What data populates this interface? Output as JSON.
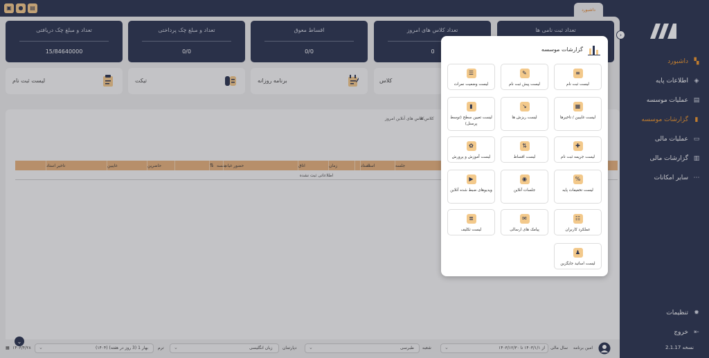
{
  "topbar": {
    "tab_label": "داشبورد"
  },
  "sidebar": {
    "items": [
      {
        "label": "داشبورد",
        "icon": "grid-icon"
      },
      {
        "label": "اطلاعات پایه",
        "icon": "layers-icon"
      },
      {
        "label": "عملیات موسسه",
        "icon": "clipboard-icon"
      },
      {
        "label": "گزارشات موسسه",
        "icon": "bar-chart-icon"
      },
      {
        "label": "عملیات مالی",
        "icon": "wallet-icon"
      },
      {
        "label": "گزارشات مالی",
        "icon": "finance-report-icon"
      },
      {
        "label": "سایر امکانات",
        "icon": "more-icon"
      }
    ],
    "settings": "تنظیمات",
    "logout": "خروج",
    "version": "نسخه 2.1.17"
  },
  "stats": [
    {
      "title": "تعداد ثبت نامی ها",
      "value": ""
    },
    {
      "title": "تعداد کلاس های امروز",
      "value": "0"
    },
    {
      "title": "اقساط معوق",
      "value": "0/0"
    },
    {
      "title": "تعداد و مبلغ چک پرداختی",
      "value": "0/0"
    },
    {
      "title": "تعداد و مبلغ چک دریافتی",
      "value": "15/84640000"
    }
  ],
  "quick_links": [
    {
      "label": "کلاس"
    },
    {
      "label": "برنامه روزانه"
    },
    {
      "label": "تیکت"
    },
    {
      "label": "لیست ثبت نام"
    }
  ],
  "panel": {
    "tabs": [
      "کلاس ها",
      "کلاس های آنلاین امروز"
    ],
    "columns": [
      "جلسه",
      "استاد",
      "زمان",
      "اتاق",
      "حضور غیاب",
      "حاضرین",
      "غایبین",
      "تاخیر استاد"
    ],
    "empty_text": "اطلاعاتی ثبت نشده"
  },
  "bottombar": {
    "user": "امین برنامه",
    "fiscal_year_label": "سال مالی",
    "fiscal_year_value": "از ۱۴۰۳/۱/۱ تا ۱۴۰۳/۱۲/۳۰",
    "branch_label": "شعبه",
    "branch_value": "طبرسی",
    "department_label": "دپارتمان",
    "department_value": "زبان انگلیسی",
    "term_label": "ترم",
    "term_value": "بهار 1 (3 روز در هفته) (۱۴۰۴)",
    "date": "۱۴۰۳/۴/۲۸"
  },
  "modal": {
    "title": "گزارشات موسسه",
    "cards": [
      {
        "label": "لیست ثبت نام",
        "icon": "document-icon"
      },
      {
        "label": "لیست پیش ثبت نام",
        "icon": "edit-document-icon"
      },
      {
        "label": "لیست وضعیت نمرات",
        "icon": "grades-icon"
      },
      {
        "label": "لیست غایبین / تاخیرها",
        "icon": "absent-list-icon"
      },
      {
        "label": "لیست ریزش ها",
        "icon": "decline-chart-icon"
      },
      {
        "label": "لیست تعیین سطح (توسط پرسنل)",
        "icon": "level-chart-icon"
      },
      {
        "label": "لیست جریمه ثبت نام",
        "icon": "penalty-icon"
      },
      {
        "label": "لیست اقساط",
        "icon": "installments-icon"
      },
      {
        "label": "لیست آموزش و پرورش",
        "icon": "education-icon"
      },
      {
        "label": "لیست تخفیفات پایه",
        "icon": "discount-icon"
      },
      {
        "label": "جلسات آنلاین",
        "icon": "online-session-icon"
      },
      {
        "label": "ویدیوهای ضبط شده آنلاین",
        "icon": "video-icon"
      },
      {
        "label": "عملکرد کاربران",
        "icon": "user-performance-icon"
      },
      {
        "label": "پیامک های ارسالی",
        "icon": "sms-icon"
      },
      {
        "label": "لیست تکلیف",
        "icon": "homework-icon"
      },
      {
        "label": "لیست اساتید جایگزین",
        "icon": "substitute-teacher-icon"
      }
    ]
  }
}
